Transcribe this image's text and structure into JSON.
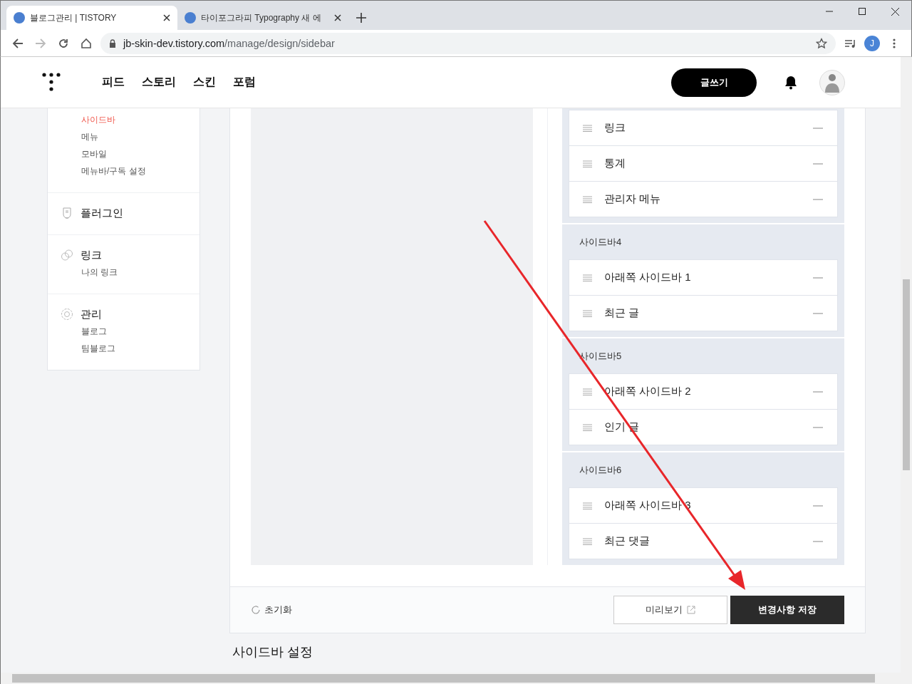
{
  "browser": {
    "tabs": [
      {
        "title": "블로그관리 | TISTORY",
        "selected": true
      },
      {
        "title": "타이포그라피 Typography 새 에",
        "selected": false
      }
    ],
    "url": {
      "domain": "jb-skin-dev.tistory.com",
      "path": "/manage/design/sidebar"
    },
    "profile_initial": "J"
  },
  "header": {
    "nav": [
      {
        "label": "피드"
      },
      {
        "label": "스토리"
      },
      {
        "label": "스킨"
      },
      {
        "label": "포럼"
      }
    ],
    "write_button": "글쓰기"
  },
  "left_menu": [
    {
      "items": [
        {
          "label": "사이드바",
          "selected": true
        },
        {
          "label": "메뉴",
          "selected": false
        },
        {
          "label": "모바일",
          "selected": false
        },
        {
          "label": "메뉴바/구독 설정",
          "selected": false
        }
      ]
    },
    {
      "kind": "plugin",
      "title": "플러그인"
    },
    {
      "kind": "link",
      "title": "링크",
      "items": [
        {
          "label": "나의 링크",
          "selected": false
        }
      ]
    },
    {
      "kind": "manage",
      "title": "관리",
      "items": [
        {
          "label": "블로그",
          "selected": false
        },
        {
          "label": "팀블로그",
          "selected": false
        }
      ]
    }
  ],
  "sidebar_groups": [
    {
      "items": [
        {
          "label": "링크"
        },
        {
          "label": "통계"
        },
        {
          "label": "관리자 메뉴"
        }
      ]
    },
    {
      "title": "사이드바4",
      "items": [
        {
          "label": "아래쪽 사이드바 1"
        },
        {
          "label": "최근 글"
        }
      ]
    },
    {
      "title": "사이드바5",
      "items": [
        {
          "label": "아래쪽 사이드바 2"
        },
        {
          "label": "인기 글"
        }
      ]
    },
    {
      "title": "사이드바6",
      "items": [
        {
          "label": "아래쪽 사이드바 3"
        },
        {
          "label": "최근 댓글"
        }
      ]
    }
  ],
  "footer": {
    "reset": "초기화",
    "preview": "미리보기",
    "save": "변경사항 저장"
  },
  "next_section_title": "사이드바 설정"
}
